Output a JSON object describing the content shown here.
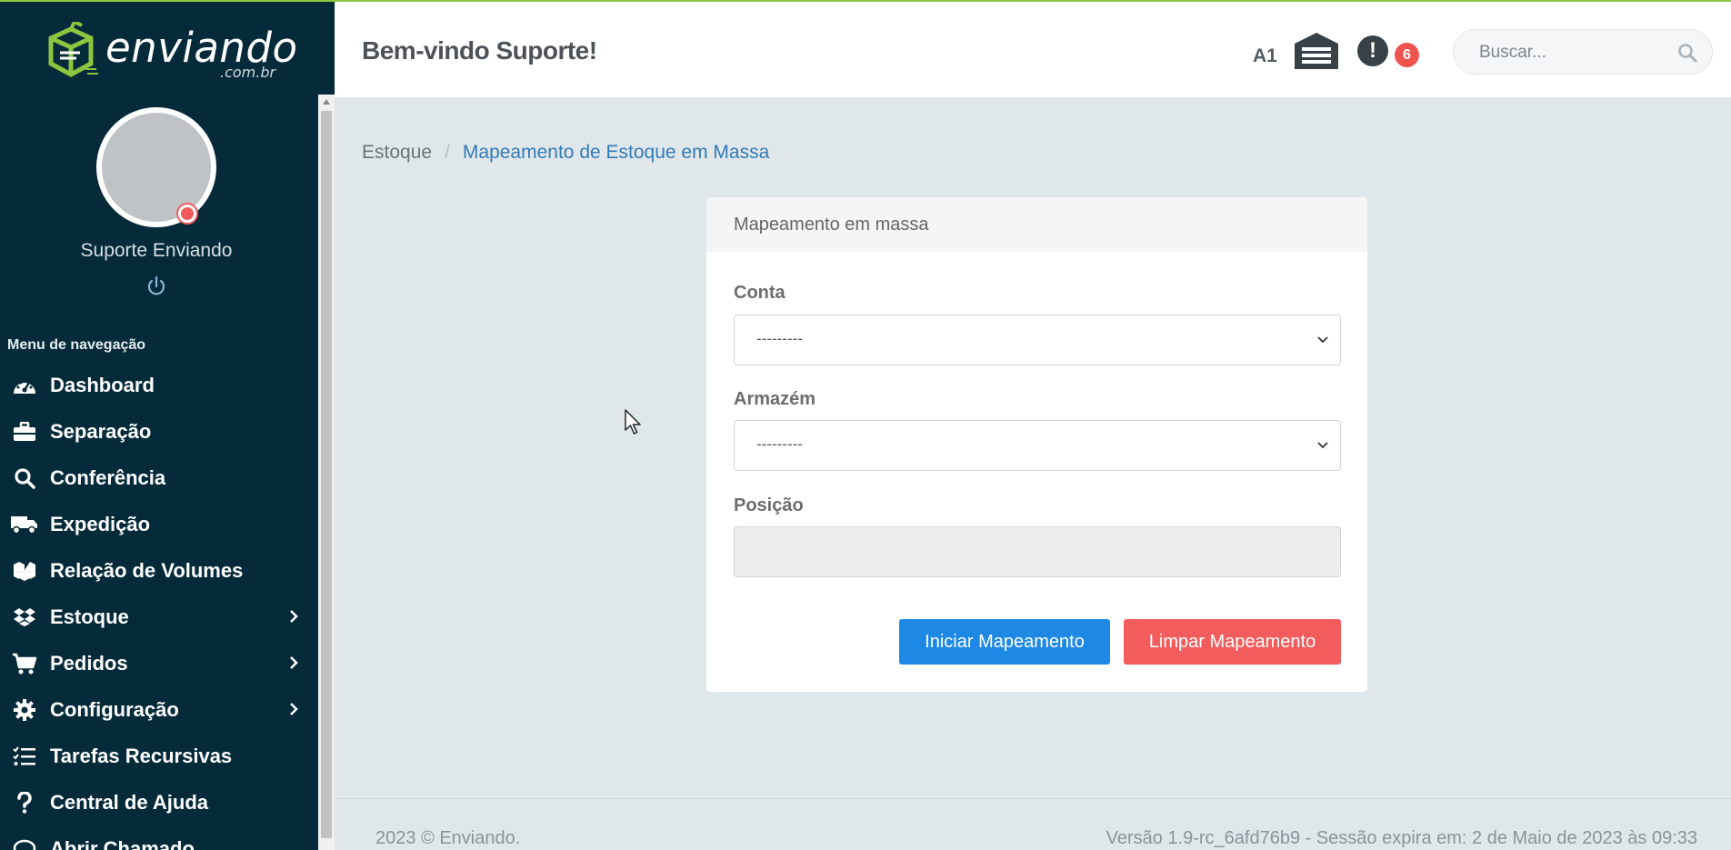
{
  "brand": {
    "name": "enviando",
    "sub": ".com.br",
    "accent_color": "#8cc63f",
    "sidebar_color": "#052b3a"
  },
  "user": {
    "name": "Suporte Enviando",
    "status_color": "#f15a5a"
  },
  "sidebar": {
    "nav_title": "Menu de navegação",
    "items": [
      {
        "label": "Dashboard",
        "icon": "gauge-icon"
      },
      {
        "label": "Separação",
        "icon": "briefcase-icon"
      },
      {
        "label": "Conferência",
        "icon": "search-icon"
      },
      {
        "label": "Expedição",
        "icon": "truck-icon"
      },
      {
        "label": "Relação de Volumes",
        "icon": "boxes-icon"
      },
      {
        "label": "Estoque",
        "icon": "dropbox-icon",
        "has_submenu": true
      },
      {
        "label": "Pedidos",
        "icon": "cart-icon",
        "has_submenu": true
      },
      {
        "label": "Configuração",
        "icon": "gear-icon",
        "has_submenu": true
      },
      {
        "label": "Tarefas Recursivas",
        "icon": "list-check-icon"
      },
      {
        "label": "Central de Ajuda",
        "icon": "question-icon"
      },
      {
        "label": "Abrir Chamado",
        "icon": "chat-icon"
      }
    ]
  },
  "header": {
    "welcome": "Bem-vindo Suporte!",
    "warehouse_code": "A1",
    "notification_count": "6",
    "search_placeholder": "Buscar..."
  },
  "breadcrumb": {
    "parent": "Estoque",
    "separator": "/",
    "current": "Mapeamento de Estoque em Massa"
  },
  "form": {
    "title": "Mapeamento em massa",
    "conta_label": "Conta",
    "conta_value": "---------",
    "armazem_label": "Armazém",
    "armazem_value": "---------",
    "posicao_label": "Posição",
    "posicao_value": "",
    "start_button": "Iniciar Mapeamento",
    "clear_button": "Limpar Mapeamento"
  },
  "footer": {
    "copyright": "2023 © Enviando.",
    "version": "Versão 1.9-rc_6afd76b9 - Sessão expira em: 2 de Maio de 2023 às 09:33"
  }
}
